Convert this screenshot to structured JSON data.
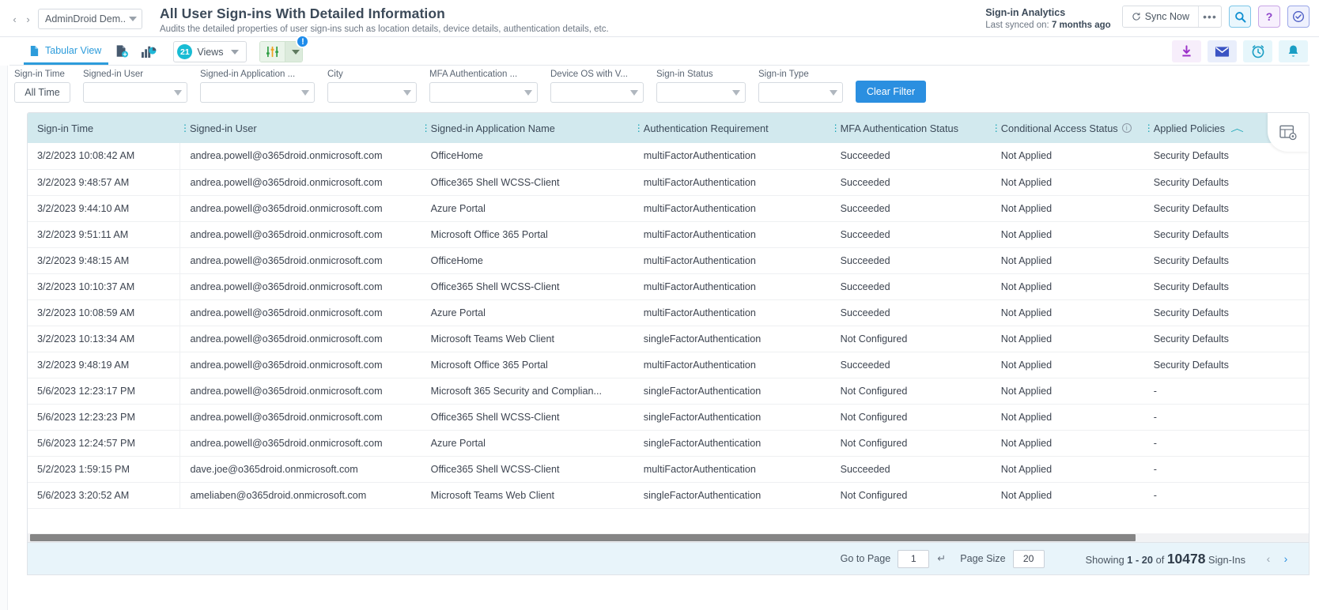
{
  "topbar": {
    "nav_back": "‹",
    "nav_forward": "›",
    "tenant": "AdminDroid Dem...",
    "title": "All User Sign-ins With Detailed Information",
    "subtitle": "Audits the detailed properties of user sign-ins such as location details, device details, authentication details, etc.",
    "sync_title": "Sign-in Analytics",
    "sync_prefix": "Last synced on: ",
    "sync_value": "7 months ago",
    "sync_now": "Sync Now",
    "more": "•••",
    "icons": {
      "search": "search-icon",
      "help": "?",
      "check": "check-circle-icon"
    }
  },
  "toolbar": {
    "tab_tabular": "Tabular View",
    "export_report_icon": "report-export-icon",
    "chart_view_icon": "chart-view-icon",
    "views_count": "21",
    "views_label": "Views",
    "filter_badge": "!",
    "actions": {
      "download": "download-icon",
      "email": "email-icon",
      "schedule": "schedule-clock-icon",
      "alert": "bell-icon"
    }
  },
  "filters": [
    {
      "label": "Sign-in Time",
      "value": "All Time",
      "type": "button"
    },
    {
      "label": "Signed-in User",
      "value": "",
      "type": "select"
    },
    {
      "label": "Signed-in Application ...",
      "value": "",
      "type": "select"
    },
    {
      "label": "City",
      "value": "",
      "type": "select"
    },
    {
      "label": "MFA Authentication ...",
      "value": "",
      "type": "select"
    },
    {
      "label": "Device OS with V...",
      "value": "",
      "type": "select"
    },
    {
      "label": "Sign-in Status",
      "value": "",
      "type": "select"
    },
    {
      "label": "Sign-in Type",
      "value": "",
      "type": "select"
    }
  ],
  "clear_filter": "Clear Filter",
  "table": {
    "columns": [
      "Sign-in Time",
      "Signed-in User",
      "Signed-in Application Name",
      "Authentication Requirement",
      "MFA Authentication Status",
      "Conditional Access Status",
      "Applied Policies"
    ],
    "sorted_column": "Applied Policies",
    "sort_direction": "asc",
    "info_column": "Conditional Access Status",
    "rows": [
      [
        "3/2/2023 10:08:42 AM",
        "andrea.powell@o365droid.onmicrosoft.com",
        "OfficeHome",
        "multiFactorAuthentication",
        "Succeeded",
        "Not Applied",
        "Security Defaults"
      ],
      [
        "3/2/2023 9:48:57 AM",
        "andrea.powell@o365droid.onmicrosoft.com",
        "Office365 Shell WCSS-Client",
        "multiFactorAuthentication",
        "Succeeded",
        "Not Applied",
        "Security Defaults"
      ],
      [
        "3/2/2023 9:44:10 AM",
        "andrea.powell@o365droid.onmicrosoft.com",
        "Azure Portal",
        "multiFactorAuthentication",
        "Succeeded",
        "Not Applied",
        "Security Defaults"
      ],
      [
        "3/2/2023 9:51:11 AM",
        "andrea.powell@o365droid.onmicrosoft.com",
        "Microsoft Office 365 Portal",
        "multiFactorAuthentication",
        "Succeeded",
        "Not Applied",
        "Security Defaults"
      ],
      [
        "3/2/2023 9:48:15 AM",
        "andrea.powell@o365droid.onmicrosoft.com",
        "OfficeHome",
        "multiFactorAuthentication",
        "Succeeded",
        "Not Applied",
        "Security Defaults"
      ],
      [
        "3/2/2023 10:10:37 AM",
        "andrea.powell@o365droid.onmicrosoft.com",
        "Office365 Shell WCSS-Client",
        "multiFactorAuthentication",
        "Succeeded",
        "Not Applied",
        "Security Defaults"
      ],
      [
        "3/2/2023 10:08:59 AM",
        "andrea.powell@o365droid.onmicrosoft.com",
        "Azure Portal",
        "multiFactorAuthentication",
        "Succeeded",
        "Not Applied",
        "Security Defaults"
      ],
      [
        "3/2/2023 10:13:34 AM",
        "andrea.powell@o365droid.onmicrosoft.com",
        "Microsoft Teams Web Client",
        "singleFactorAuthentication",
        "Not Configured",
        "Not Applied",
        "Security Defaults"
      ],
      [
        "3/2/2023 9:48:19 AM",
        "andrea.powell@o365droid.onmicrosoft.com",
        "Microsoft Office 365 Portal",
        "multiFactorAuthentication",
        "Succeeded",
        "Not Applied",
        "Security Defaults"
      ],
      [
        "5/6/2023 12:23:17 PM",
        "andrea.powell@o365droid.onmicrosoft.com",
        "Microsoft 365 Security and Complian...",
        "singleFactorAuthentication",
        "Not Configured",
        "Not Applied",
        "-"
      ],
      [
        "5/6/2023 12:23:23 PM",
        "andrea.powell@o365droid.onmicrosoft.com",
        "Office365 Shell WCSS-Client",
        "singleFactorAuthentication",
        "Not Configured",
        "Not Applied",
        "-"
      ],
      [
        "5/6/2023 12:24:57 PM",
        "andrea.powell@o365droid.onmicrosoft.com",
        "Azure Portal",
        "singleFactorAuthentication",
        "Not Configured",
        "Not Applied",
        "-"
      ],
      [
        "5/2/2023 1:59:15 PM",
        "dave.joe@o365droid.onmicrosoft.com",
        "Office365 Shell WCSS-Client",
        "multiFactorAuthentication",
        "Succeeded",
        "Not Applied",
        "-"
      ],
      [
        "5/6/2023 3:20:52 AM",
        "ameliaben@o365droid.onmicrosoft.com",
        "Microsoft Teams Web Client",
        "singleFactorAuthentication",
        "Not Configured",
        "Not Applied",
        "-"
      ]
    ]
  },
  "footer": {
    "go_to_page_label": "Go to Page",
    "page_value": "1",
    "enter_icon": "↵",
    "page_size_label": "Page Size",
    "page_size_value": "20",
    "showing_prefix": "Showing ",
    "showing_range": "1 - 20",
    "showing_of": " of ",
    "showing_total": "10478",
    "showing_suffix": " Sign-Ins",
    "prev": "‹",
    "next": "›"
  },
  "colors": {
    "accent_blue": "#2b8fe0",
    "header_teal": "#d2e9ee",
    "tab_blue": "#2d9cdb",
    "badge_cyan": "#18bcd4",
    "footer_bg": "#e8f4fa"
  }
}
